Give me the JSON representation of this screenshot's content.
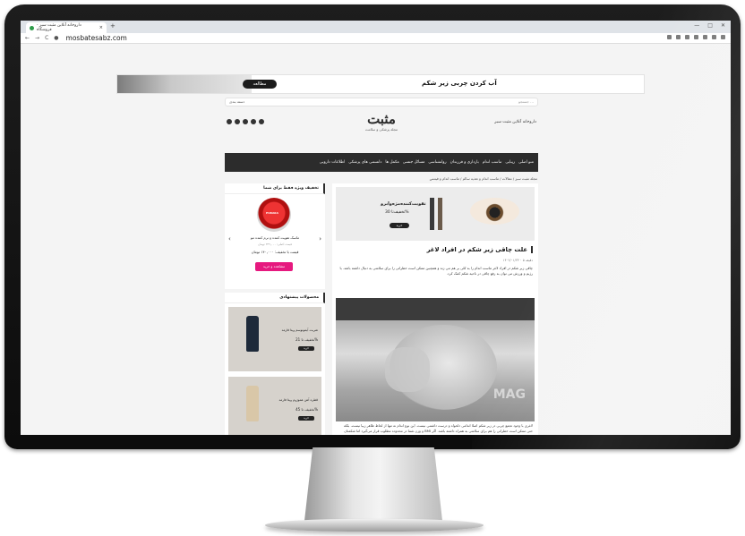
{
  "browser": {
    "tab_title": "داروخانه آنلاین مثبت سبز - فروشگاه",
    "new_tab": "+",
    "window_controls": [
      "—",
      "□",
      "✕"
    ],
    "url": "mosbatesabz.com"
  },
  "banner": {
    "badge": "مطالعه",
    "title": "آب کردن چربی زیر شکم"
  },
  "header": {
    "search_placeholder": "جستجو ...",
    "search_category": "دسته بندی",
    "logo_text": "مثبت",
    "logo_sub": "مجله پزشکی و سلامت",
    "home_link": "داروخانه آنلاین مثبت سبز"
  },
  "nav": {
    "items": [
      "منو اصلی",
      "زیبایی",
      "تناسب اندام",
      "بارداری و فرزندان",
      "روانشناسی",
      "مسائل جنسی",
      "مکمل ها",
      "دانستنی های پزشکی",
      "اطلاعات دارویی"
    ]
  },
  "breadcrumb": "مجله مثبت سبز / مقالات / تناسب اندام و تغذیه سالم / تناسب اندام و فیتنس",
  "article": {
    "ad_line1": "تقویت‌کننده‌مژه‌وابرو",
    "ad_line2": "تخفیف‌تا 30%",
    "ad_button": "خرید",
    "title": "علت چاقی زیر شکم در افراد لاغر",
    "meta": "۱۴۰۲/۰۱/۲۳  ۰  ۵ دقیقه",
    "intro": "چاقی زیر شکم در افراد لاغر تناسب اندام را به کلی بر هم می زند و همچنین ممکن است خطراتی را برای سلامتی به دنبال داشته باشد. با رژیم و ورزش می توان به رفع چاقی در ناحیه شکم کمک کرد.",
    "watermark": "MAG",
    "paragraph": "لاغری با وجود تجمع چربی در زیر شکم اصلا اندامی دلخواه و درست داشتنی نیست. این نوع اندام نه تنها از لحاظ ظاهر زیبا نیست، بلکه حتی ممکن است خطراتی را هم برای سلامتی به همراه داشته باشد. اگر BMI و وزن شما در محدوده مطلوب قرار می‌گیرد اما شکمتان برجسته است، همچنان احتمال دارد که شما در معرض ابتلا به برخی"
  },
  "sidebar": {
    "offer_title": "تخفیف ویژه فقط برای شما",
    "product_brand": "PURAKA",
    "product_name": "ماسک تقویت کننده و نرم کننده مو",
    "old_price": "قیمت اصلی: ۲۴۹,۰۰۰ تومان",
    "new_price": "قیمت با تخفیف: ۱۴۰,۰۰۰ تومان",
    "view_button": "مشاهده و خرید",
    "rec_title": "محصولات پیشنهادی",
    "cards": [
      {
        "name": "شربت آیمونوسم ویتا فارمد",
        "discount": "تخفیف تا 21%",
        "buy": "خرید"
      },
      {
        "name": "قطره آهن هموژوم ویتا فارمد",
        "discount": "تخفیف تا 45%",
        "buy": "خرید"
      }
    ]
  },
  "colors": {
    "navbar": "#2c2c2c",
    "accent_pink": "#e6197f",
    "brand_green": "#2e9c4a"
  }
}
